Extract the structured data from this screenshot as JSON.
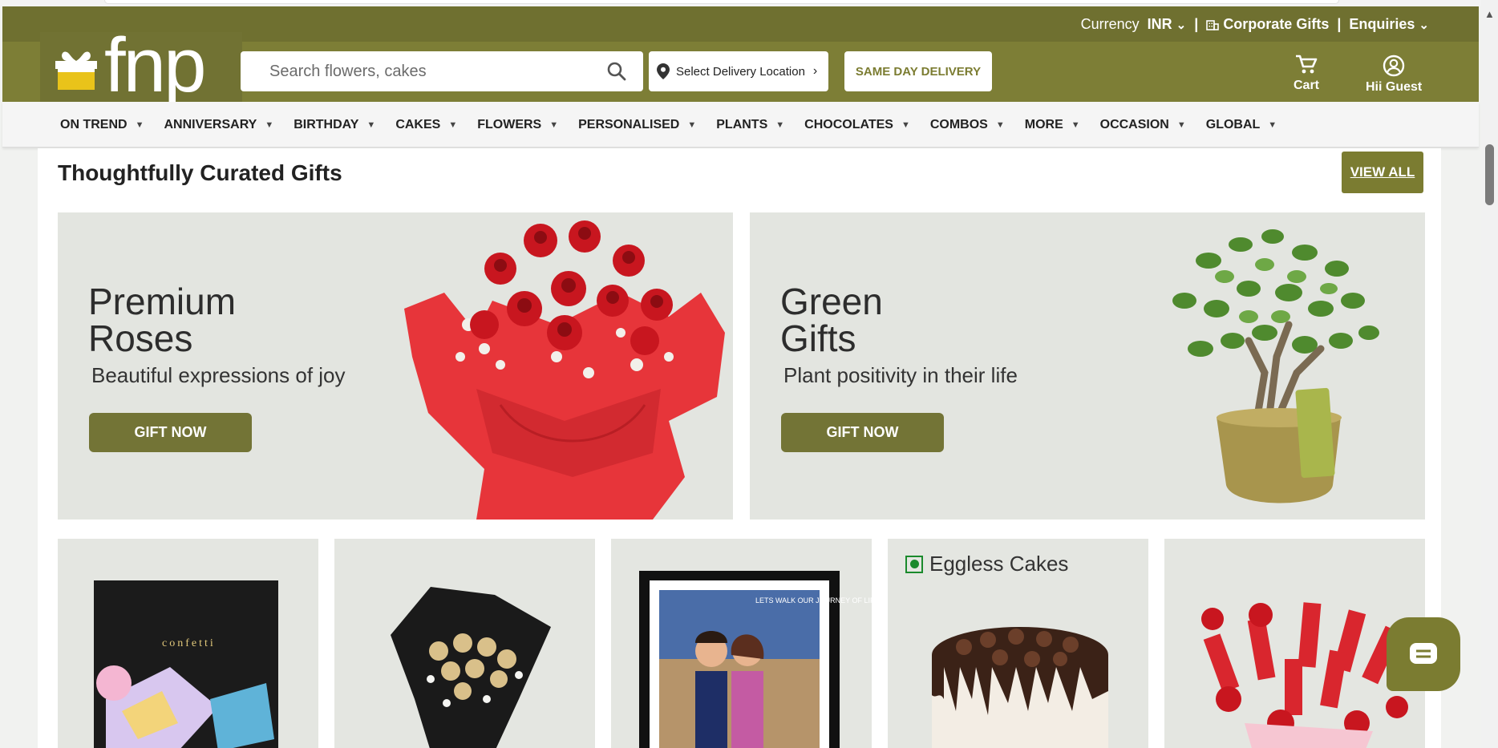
{
  "header": {
    "currency_label": "Currency",
    "currency_value": "INR",
    "corporate_gifts": "Corporate Gifts",
    "enquiries": "Enquiries",
    "separator": "|",
    "logo_text": "fnp",
    "search_placeholder": "Search flowers, cakes",
    "location_label": "Select Delivery Location",
    "same_day": "SAME DAY DELIVERY",
    "cart_label": "Cart",
    "account_label": "Hii Guest"
  },
  "nav": {
    "items": [
      {
        "label": "ON TREND"
      },
      {
        "label": "ANNIVERSARY"
      },
      {
        "label": "BIRTHDAY"
      },
      {
        "label": "CAKES"
      },
      {
        "label": "FLOWERS"
      },
      {
        "label": "PERSONALISED"
      },
      {
        "label": "PLANTS"
      },
      {
        "label": "CHOCOLATES"
      },
      {
        "label": "COMBOS"
      },
      {
        "label": "MORE"
      },
      {
        "label": "OCCASION"
      },
      {
        "label": "GLOBAL"
      }
    ]
  },
  "section": {
    "title": "Thoughtfully Curated Gifts",
    "view_all": "VIEW ALL"
  },
  "banners": [
    {
      "title_line1": "Premium",
      "title_line2": "Roses",
      "subtitle": "Beautiful expressions of joy",
      "button": "GIFT NOW"
    },
    {
      "title_line1": "Green",
      "title_line2": "Gifts",
      "subtitle": "Plant positivity in their life",
      "button": "GIFT NOW"
    }
  ],
  "tiles": {
    "confetti_text": "confetti",
    "eggless": "Eggless Cakes",
    "caricature_text": "LETS WALK OUR JOURNEY OF LIFE TOGETHER SHALL WE?"
  },
  "colors": {
    "brand_olive": "#7d7e36",
    "brand_dark": "#6f7030",
    "button_olive": "#737436"
  }
}
